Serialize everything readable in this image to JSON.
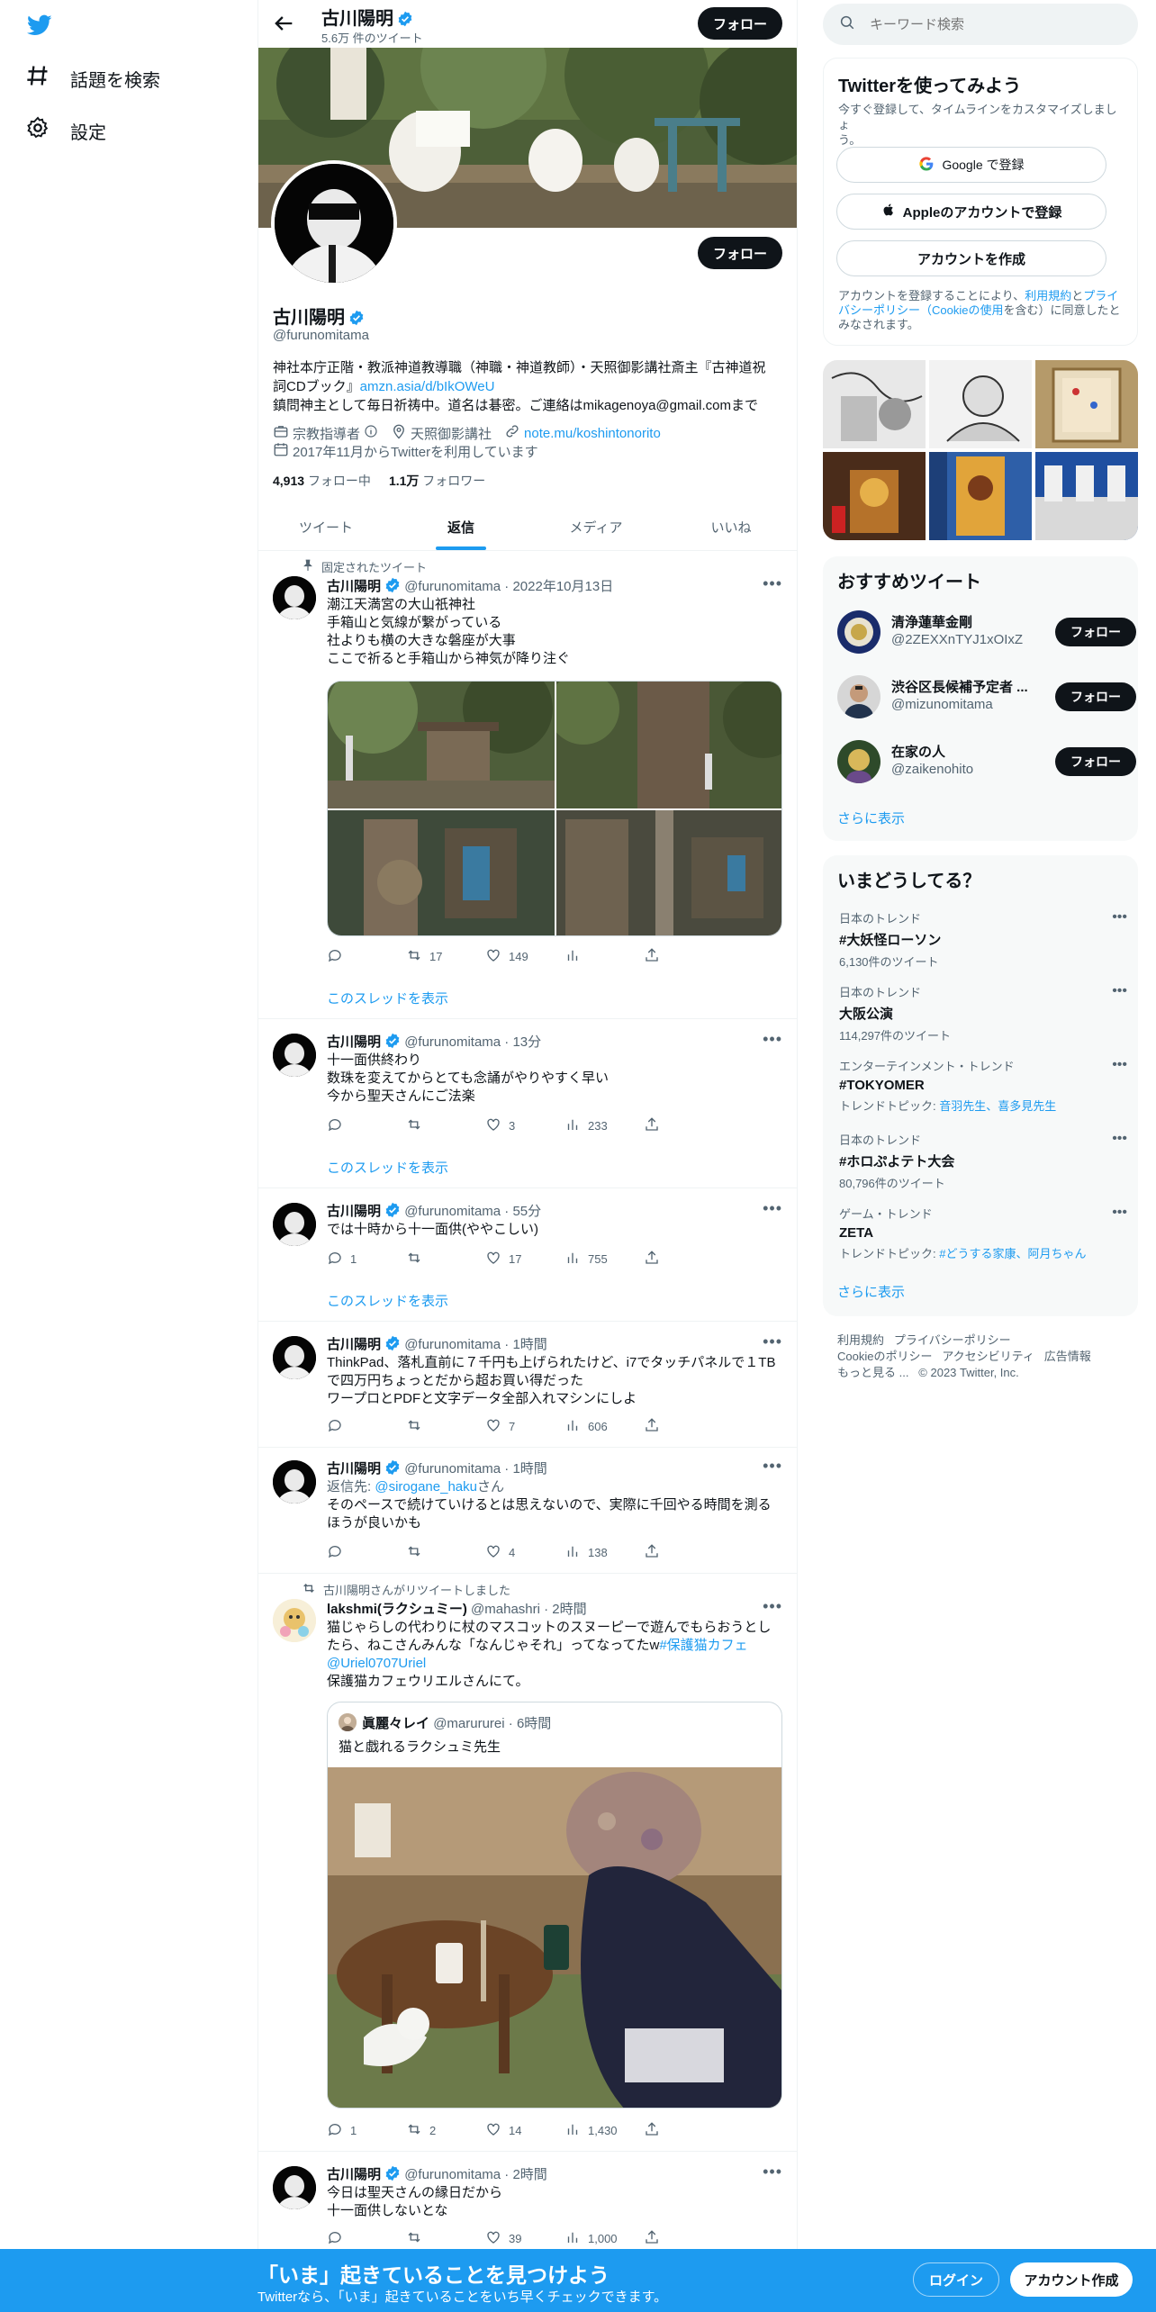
{
  "nav": {
    "explore_label": "話題を検索",
    "settings_label": "設定"
  },
  "header": {
    "name": "古川陽明",
    "tweet_count": "5.6万 件のツイート",
    "follow_label": "フォロー"
  },
  "profile": {
    "name": "古川陽明",
    "handle": "@furunomitama",
    "follow_label": "フォロー",
    "bio_line1": "神社本庁正階・教派神道教導職（神職・神道教師）・天照御影講社斎主『古神道祝",
    "bio_line2_text": "詞CDブック』",
    "bio_link": "amzn.asia/d/bIkOWeU",
    "bio_line3": "鎮問神主として毎日祈祷中。道名は碁密。ご連絡はmikagenoya@gmail.comまで",
    "category": "宗教指導者",
    "location": "天照御影講社",
    "url": "note.mu/koshintonorito",
    "joined": "2017年11月からTwitterを利用しています",
    "following_count": "4,913",
    "following_label": "フォロー中",
    "followers_count": "1.1万",
    "followers_label": "フォロワー"
  },
  "tabs": [
    "ツイート",
    "返信",
    "メディア",
    "いいね"
  ],
  "active_tab": "返信",
  "tweets": [
    {
      "pinned_label": "固定されたツイート",
      "name": "古川陽明",
      "handle": "@furunomitama",
      "time": "2022年10月13日",
      "lines": [
        "潮江天満宮の大山祇神社",
        "手箱山と気線が繋がっている",
        "社よりも横の大きな磐座が大事",
        "ここで祈ると手箱山から神気が降り注ぐ"
      ],
      "replies": "",
      "retweets": "17",
      "likes": "149",
      "views": "",
      "show_thread": "このスレッドを表示"
    },
    {
      "name": "古川陽明",
      "handle": "@furunomitama",
      "time": "13分",
      "lines": [
        "十一面供終わり",
        "数珠を変えてからとても念誦がやりやすく早い",
        "今から聖天さんにご法楽"
      ],
      "replies": "",
      "retweets": "",
      "likes": "3",
      "views": "233",
      "show_thread": "このスレッドを表示"
    },
    {
      "name": "古川陽明",
      "handle": "@furunomitama",
      "time": "55分",
      "lines": [
        "では十時から十一面供(ややこしい)"
      ],
      "replies": "1",
      "retweets": "",
      "likes": "17",
      "views": "755",
      "show_thread": "このスレッドを表示"
    },
    {
      "name": "古川陽明",
      "handle": "@furunomitama",
      "time": "1時間",
      "lines": [
        "ThinkPad、落札直前に７千円も上げられたけど、i7でタッチパネルで１TB",
        "で四万円ちょっとだから超お買い得だった",
        "ワープロとPDFと文字データ全部入れマシンにしよ"
      ],
      "replies": "",
      "retweets": "",
      "likes": "7",
      "views": "606"
    },
    {
      "name": "古川陽明",
      "handle": "@furunomitama",
      "time": "1時間",
      "reply_to_label": "返信先:",
      "reply_to_handle": "@sirogane_haku",
      "reply_to_suffix": "さん",
      "lines": [
        "そのペースで続けていけるとは思えないので、実際に千回やる時間を測る",
        "ほうが良いかも"
      ],
      "replies": "",
      "retweets": "",
      "likes": "4",
      "views": "138"
    },
    {
      "retweet_label": "古川陽明さんがリツイートしました",
      "name": "lakshmi(ラクシュミー)",
      "handle": "@mahashri",
      "time": "2時間",
      "line1": "猫じゃらしの代わりに杖のマスコットのスヌーピーで遊んでもらおうとし",
      "line2_text": "たら、ねこさんみんな「なんじゃそれ」ってなってたw",
      "line2_tag": "#保護猫カフェ",
      "line3_mention": "@Uriel0707Uriel",
      "line4": "保護猫カフェウリエルさんにて。",
      "quote_name": "眞麗々レイ",
      "quote_handle": "@marururei",
      "quote_time": "6時間",
      "quote_text": "猫と戯れるラクシュミ先生",
      "replies": "1",
      "retweets": "2",
      "likes": "14",
      "views": "1,430"
    },
    {
      "name": "古川陽明",
      "handle": "@furunomitama",
      "time": "2時間",
      "lines": [
        "今日は聖天さんの縁日だから",
        "十一面供しないとな"
      ],
      "replies": "",
      "retweets": "",
      "likes": "39",
      "views": "1,000"
    }
  ],
  "search": {
    "placeholder": "キーワード検索"
  },
  "signup": {
    "title": "Twitterを使ってみよう",
    "subtitle_line1": "今すぐ登録して、タイムラインをカスタマイズしましょ",
    "subtitle_line2": "う。",
    "google_label": "Google で登録",
    "apple_label": "Appleのアカウントで登録",
    "create_label": "アカウントを作成",
    "legal_1": "アカウントを登録することにより、",
    "legal_terms": "利用規約",
    "legal_and": "と",
    "legal_privacy": "プライ",
    "legal_privacy2": "バシーポリシー（Cookieの使用",
    "legal_2": "を含む）に同意したと",
    "legal_3": "みなされます。"
  },
  "recommended": {
    "title": "おすすめツイート",
    "users": [
      {
        "name": "清浄蓮華金剛",
        "handle": "@2ZEXXnTYJ1xOIxZ",
        "follow": "フォロー"
      },
      {
        "name": "渋谷区長候補予定者 ...",
        "handle": "@mizunomitama",
        "follow": "フォロー"
      },
      {
        "name": "在家の人",
        "handle": "@zaikenohito",
        "follow": "フォロー"
      }
    ],
    "show_more": "さらに表示"
  },
  "trends": {
    "title": "いまどうしてる？",
    "items": [
      {
        "context": "日本のトレンド",
        "name": "#大妖怪ローソン",
        "sub": "6,130件のツイート"
      },
      {
        "context": "日本のトレンド",
        "name": "大阪公演",
        "sub": "114,297件のツイート"
      },
      {
        "context": "エンターテインメント・トレンド",
        "name": "#TOKYOMER",
        "sub_label": "トレンドトピック: ",
        "sub_link": "音羽先生、喜多見先生"
      },
      {
        "context": "日本のトレンド",
        "name": "#ホロぷよテト大会",
        "sub": "80,796件のツイート"
      },
      {
        "context": "ゲーム・トレンド",
        "name": "ZETA",
        "sub_label": "トレンドトピック: ",
        "sub_link": "#どうする家康、阿月ちゃん"
      }
    ],
    "show_more": "さらに表示"
  },
  "footer": {
    "terms": "利用規約",
    "privacy": "プライバシーポリシー",
    "cookie": "Cookieのポリシー",
    "accessibility": "アクセシビリティ",
    "ads": "広告情報",
    "more": "もっと見る ...",
    "copyright": "© 2023 Twitter, Inc."
  },
  "banner": {
    "title": "「いま」起きていることを見つけよう",
    "subtitle": "Twitterなら、「いま」起きていることをいち早くチェックできます。",
    "login": "ログイン",
    "signup": "アカウント作成"
  },
  "colors": {
    "accent": "#1d9bf0",
    "banner": "#1d9bf0",
    "text": "#0f1419",
    "secondary": "#536471"
  }
}
